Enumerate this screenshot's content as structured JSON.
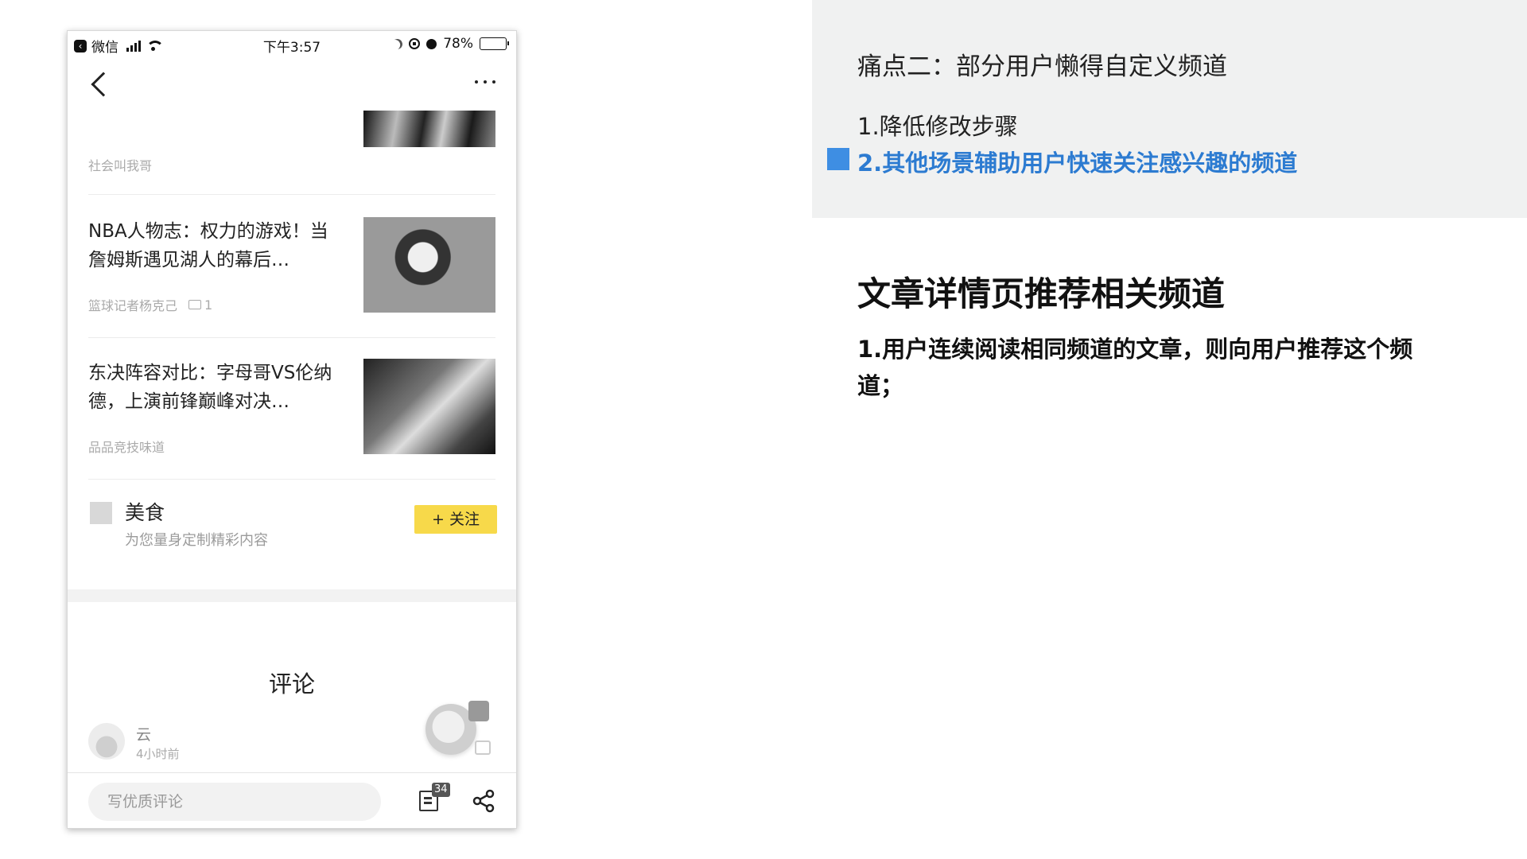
{
  "status_bar": {
    "back_app": "微信",
    "time": "下午3:57",
    "battery": "78%",
    "battery_level": 0.78
  },
  "articles": [
    {
      "title": "",
      "meta": "社会叫我哥",
      "comments": ""
    },
    {
      "title": "NBA人物志：权力的游戏！当詹姆斯遇见湖人的幕后…",
      "meta": "篮球记者杨克己",
      "comments": "1"
    },
    {
      "title": "东决阵容对比：字母哥VS伦纳德，上演前锋巅峰对决…",
      "meta": "品品竞技味道",
      "comments": ""
    }
  ],
  "channel": {
    "name": "美食",
    "desc": "为您量身定制精彩内容",
    "follow_label": "+ 关注"
  },
  "comments_section": {
    "title": "评论",
    "items": [
      {
        "user": "云",
        "time": "4小时前"
      }
    ]
  },
  "bottom_bar": {
    "input_placeholder": "写优质评论",
    "comment_count": "34"
  },
  "notes": {
    "pain_title": "痛点二：部分用户懒得自定义频道",
    "step_one": "1.降低修改步骤",
    "step_two": "2.其他场景辅助用户快速关注感兴趣的频道",
    "marker_color": "#3e8ee3",
    "highlight_color": "#2c7bd1",
    "section_heading": "文章详情页推荐相关频道",
    "section_body": "1.用户连续阅读相同频道的文章，则向用户推荐这个频道；"
  },
  "colors": {
    "follow_button": "#f7d94a",
    "panel_bg": "#f0f1f1"
  }
}
